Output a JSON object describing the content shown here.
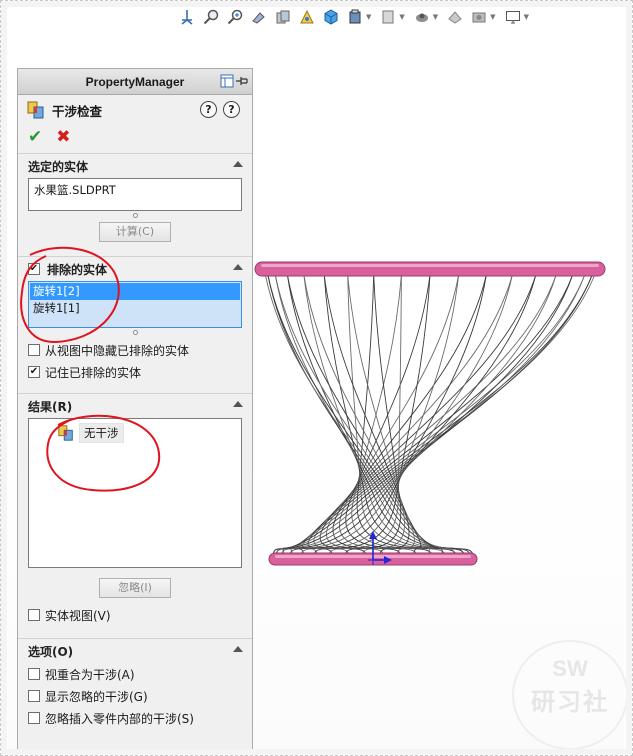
{
  "panel": {
    "header_title": "PropertyManager",
    "feature_title": "干涉检查",
    "sections": {
      "selected": {
        "title": "选定的实体",
        "field_value": "水果篮.SLDPRT",
        "button": "计算(C)"
      },
      "excluded": {
        "title": "排除的实体",
        "checked": true,
        "items": [
          {
            "label": "旋转1[2]",
            "selected": true
          },
          {
            "label": "旋转1[1]",
            "selected": false
          }
        ],
        "options": [
          {
            "label": "从视图中隐藏已排除的实体",
            "checked": false
          },
          {
            "label": "记住已排除的实体",
            "checked": true
          }
        ]
      },
      "results": {
        "title": "结果(R)",
        "item": "无干涉",
        "button": "忽略(I)",
        "view_option": {
          "label": "实体视图(V)",
          "checked": false
        }
      },
      "options": {
        "title": "选项(O)",
        "items": [
          {
            "label": "视重合为干涉(A)",
            "checked": false
          },
          {
            "label": "显示忽略的干涉(G)",
            "checked": false
          },
          {
            "label": "忽略插入零件内部的干涉(S)",
            "checked": false
          }
        ]
      }
    }
  },
  "watermark": {
    "top": "SW",
    "bottom": "研习社"
  },
  "colors": {
    "accent_green": "#2d9a2d",
    "cancel_red": "#d21f1f",
    "selection_blue": "#3399ff",
    "annotation_red": "#e0141e",
    "rim_pink": "#d8609c"
  }
}
